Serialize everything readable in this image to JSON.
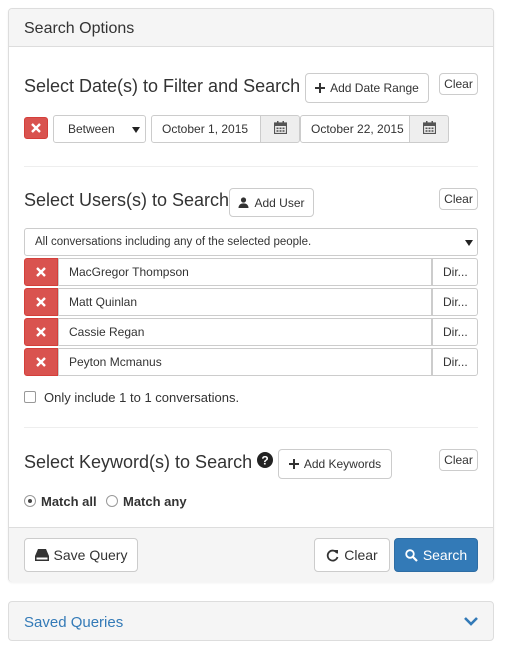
{
  "panel": {
    "title": "Search Options"
  },
  "dates": {
    "title": "Select Date(s) to Filter and Search",
    "add_label": "Add Date Range",
    "clear_label": "Clear",
    "operator": "Between",
    "start": "October 1, 2015",
    "end": "October 22, 2015"
  },
  "users": {
    "title": "Select Users(s) to Search",
    "add_label": "Add User",
    "clear_label": "Clear",
    "mode": "All conversations including any of the selected people.",
    "rows": [
      {
        "name": "MacGregor Thompson",
        "dir": "Dir..."
      },
      {
        "name": "Matt Quinlan",
        "dir": "Dir..."
      },
      {
        "name": "Cassie Regan",
        "dir": "Dir..."
      },
      {
        "name": "Peyton Mcmanus",
        "dir": "Dir..."
      }
    ],
    "one_to_one_label": "Only include 1 to 1 conversations."
  },
  "keywords": {
    "title": "Select Keyword(s) to Search",
    "add_label": "Add Keywords",
    "clear_label": "Clear",
    "match_all": "Match all",
    "match_any": "Match any"
  },
  "footer": {
    "save_label": "Save Query",
    "clear_label": "Clear",
    "search_label": "Search"
  },
  "saved": {
    "title": "Saved Queries"
  },
  "colors": {
    "primary": "#337ab7",
    "danger": "#d9534f",
    "panel_bg": "#f5f5f5"
  }
}
